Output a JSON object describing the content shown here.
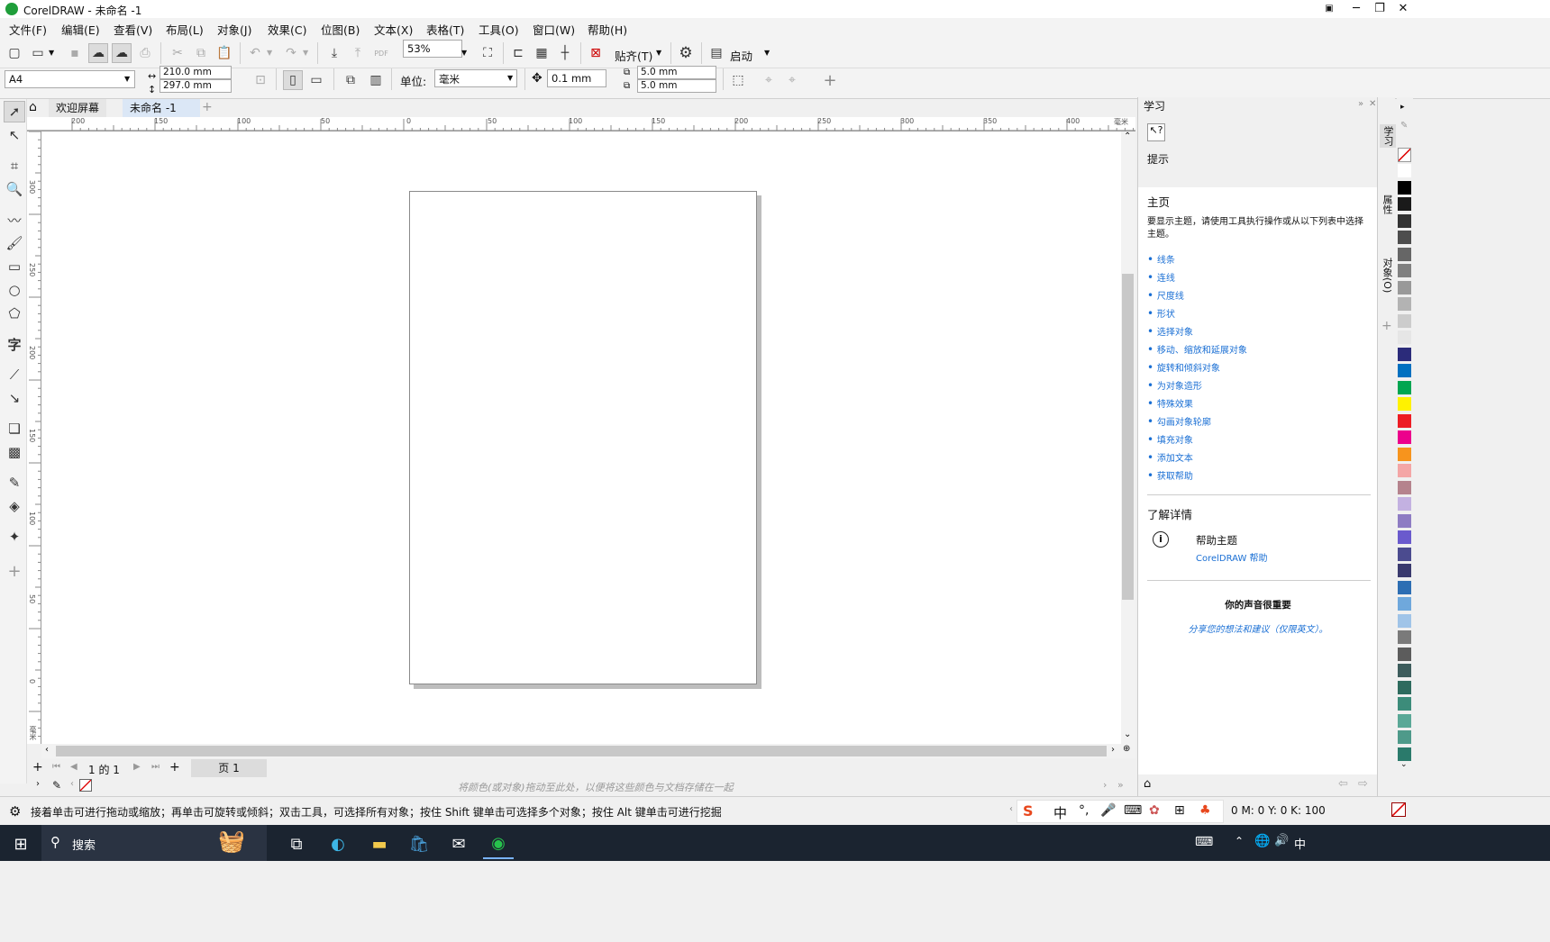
{
  "window": {
    "title": "CorelDRAW - 未命名 -1"
  },
  "menu": [
    "文件(F)",
    "编辑(E)",
    "查看(V)",
    "布局(L)",
    "对象(J)",
    "效果(C)",
    "位图(B)",
    "文本(X)",
    "表格(T)",
    "工具(O)",
    "窗口(W)",
    "帮助(H)"
  ],
  "toolbar": {
    "zoom": "53%",
    "snap_label": "贴齐(T)",
    "launch_label": "启动"
  },
  "property_bar": {
    "page_size": "A4",
    "width": "210.0 mm",
    "height": "297.0 mm",
    "unit_label": "单位:",
    "unit_value": "毫米",
    "nudge": "0.1 mm",
    "dup_x": "5.0 mm",
    "dup_y": "5.0 mm"
  },
  "doc_tabs": {
    "welcome": "欢迎屏幕",
    "document": "未命名 -1"
  },
  "rulers": {
    "horizontal": [
      "200",
      "150",
      "100",
      "50",
      "0",
      "50",
      "100",
      "150",
      "200",
      "250",
      "300",
      "350",
      "400"
    ],
    "h_unit": "毫米",
    "vertical": [
      "300",
      "250",
      "200",
      "150",
      "100",
      "50",
      "0"
    ],
    "v_unit": "毫米"
  },
  "page_nav": {
    "counter": "1 的 1",
    "page_tab": "页 1"
  },
  "color_bar": {
    "hint": "将颜色(或对象)拖动至此处，以便将这些颜色与文档存储在一起"
  },
  "docker": {
    "title": "学习",
    "hint_label": "提示",
    "home_heading": "主页",
    "home_desc": "要显示主题，请使用工具执行操作或从以下列表中选择主题。",
    "topics": [
      "线条",
      "连线",
      "尺度线",
      "形状",
      "选择对象",
      "移动、缩放和延展对象",
      "旋转和倾斜对象",
      "为对象造形",
      "特殊效果",
      "勾画对象轮廓",
      "填充对象",
      "添加文本",
      "获取帮助"
    ],
    "more_heading": "了解详情",
    "help_title": "帮助主题",
    "help_link": "CorelDRAW 帮助",
    "feedback_title": "你的声音很重要",
    "feedback_link": "分享您的想法和建议（仅限英文）。"
  },
  "docker_tabs": [
    "学习",
    "属性",
    "对象(O)"
  ],
  "palette": [
    "#ffffff",
    "#000000",
    "#1a1a1a",
    "#333333",
    "#4d4d4d",
    "#666666",
    "#808080",
    "#999999",
    "#b3b3b3",
    "#cccccc",
    "#e6e6e6",
    "#2b2b7a",
    "#0070c0",
    "#00a651",
    "#fff200",
    "#ed1c24",
    "#ec008c",
    "#f7941d",
    "#f4a6a6",
    "#b5838d",
    "#c3b1e1",
    "#8e7cc3",
    "#6a5acd",
    "#4b4b8f",
    "#3a3a6e",
    "#2d6eb3",
    "#6fa8dc",
    "#a0c4e8",
    "#7a7a7a",
    "#5c5c5c",
    "#3d5c5c",
    "#2e6b5e",
    "#3c8c7a",
    "#5aa897",
    "#4e9a8a",
    "#2a7a6b"
  ],
  "status": {
    "message": "接着单击可进行拖动或缩放；再单击可旋转或倾斜；双击工具，可选择所有对象；按住 Shift 键单击可选择多个对象；按住 Alt 键单击可进行挖掘",
    "cmyk": "0 M:  0 Y:  0 K:  100"
  },
  "ime": {
    "lang": "中"
  },
  "taskbar": {
    "search_placeholder": "搜索",
    "tray_lang": "中"
  }
}
